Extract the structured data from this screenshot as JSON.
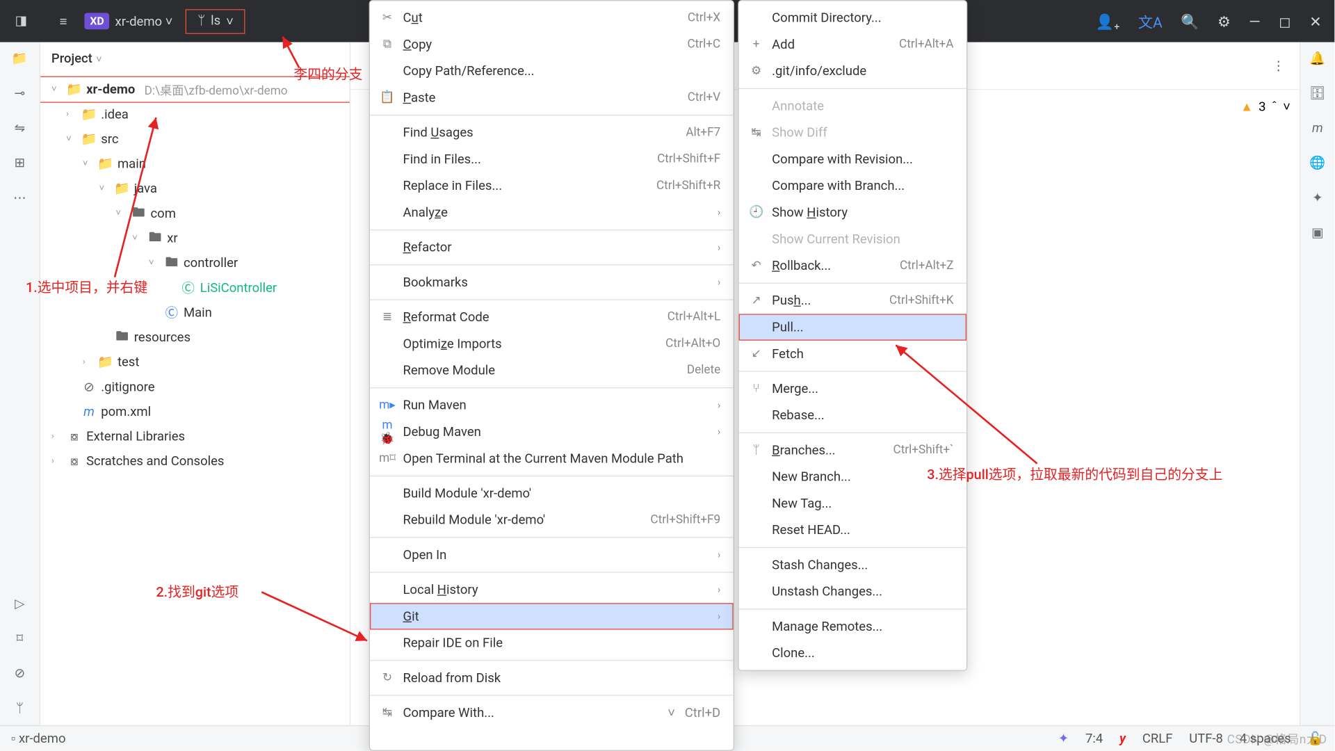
{
  "topbar": {
    "project_short": "XD",
    "project_name": "xr-demo",
    "branch": "ls"
  },
  "sidebar": {
    "title": "Project",
    "root": {
      "name": "xr-demo",
      "path": "D:\\桌面\\zfb-demo\\xr-demo"
    },
    "nodes": {
      "idea": ".idea",
      "src": "src",
      "main": "main",
      "java": "java",
      "com": "com",
      "xr": "xr",
      "controller": "controller",
      "lisi": "LiSiController",
      "mainclass": "Main",
      "resources": "resources",
      "test": "test",
      "gitignore": ".gitignore",
      "pom": "pom.xml",
      "extlib": "External Libraries",
      "scratch": "Scratches and Consoles"
    }
  },
  "editor": {
    "warn_count": "3"
  },
  "menu1": {
    "cut": "Cut",
    "cut_sc": "Ctrl+X",
    "copy": "Copy",
    "copy_sc": "Ctrl+C",
    "copypath": "Copy Path/Reference...",
    "paste": "Paste",
    "paste_sc": "Ctrl+V",
    "findusages": "Find Usages",
    "findusages_sc": "Alt+F7",
    "findfiles": "Find in Files...",
    "findfiles_sc": "Ctrl+Shift+F",
    "replacefiles": "Replace in Files...",
    "replacefiles_sc": "Ctrl+Shift+R",
    "analyze": "Analyze",
    "refactor": "Refactor",
    "bookmarks": "Bookmarks",
    "reformat": "Reformat Code",
    "reformat_sc": "Ctrl+Alt+L",
    "optimize": "Optimize Imports",
    "optimize_sc": "Ctrl+Alt+O",
    "removemod": "Remove Module",
    "removemod_sc": "Delete",
    "runmvn": "Run Maven",
    "debugmvn": "Debug Maven",
    "openterm": "Open Terminal at the Current Maven Module Path",
    "buildmod": "Build Module 'xr-demo'",
    "rebuildmod": "Rebuild Module 'xr-demo'",
    "rebuildmod_sc": "Ctrl+Shift+F9",
    "openin": "Open In",
    "localhist": "Local History",
    "git": "Git",
    "repair": "Repair IDE on File",
    "reload": "Reload from Disk",
    "compare": "Compare With...",
    "compare_sc": "Ctrl+D"
  },
  "menu2": {
    "commitdir": "Commit Directory...",
    "add": "Add",
    "add_sc": "Ctrl+Alt+A",
    "exclude": ".git/info/exclude",
    "annotate": "Annotate",
    "showdiff": "Show Diff",
    "cmprev": "Compare with Revision...",
    "cmpbranch": "Compare with Branch...",
    "showhist": "Show History",
    "showcur": "Show Current Revision",
    "rollback": "Rollback...",
    "rollback_sc": "Ctrl+Alt+Z",
    "push": "Push...",
    "push_sc": "Ctrl+Shift+K",
    "pull": "Pull...",
    "fetch": "Fetch",
    "merge": "Merge...",
    "rebase": "Rebase...",
    "branches": "Branches...",
    "branches_sc": "Ctrl+Shift+`",
    "newbranch": "New Branch...",
    "newtag": "New Tag...",
    "resethead": "Reset HEAD...",
    "stash": "Stash Changes...",
    "unstash": "Unstash Changes...",
    "remotes": "Manage Remotes...",
    "clone": "Clone..."
  },
  "annotations": {
    "a1": "李四的分支",
    "a2": "1.选中项目，并右键",
    "a3": "2.找到git选项",
    "a4": "3.选择pull选项，拉取最新的代码到自己的分支上"
  },
  "status": {
    "breadcrumb": "xr-demo",
    "pos": "7:4",
    "crlf": "CRLF",
    "enc": "UTF-8",
    "spaces": "4 spaces"
  },
  "watermark": "CSDN @格局n大D"
}
